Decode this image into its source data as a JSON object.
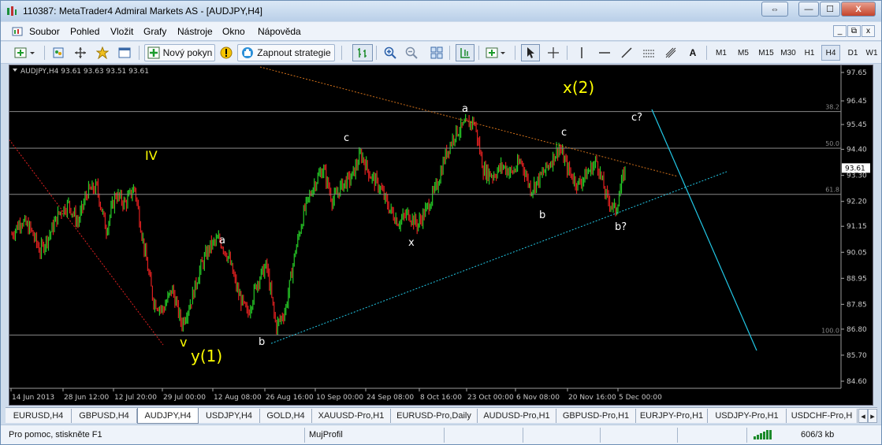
{
  "window": {
    "title": "110387: MetaTrader4 Admiral Markets AS - [AUDJPY,H4]",
    "buttons": {
      "switch": "⇔",
      "minimize": "—",
      "maximize": "☐",
      "close": "X"
    }
  },
  "menu": {
    "items": [
      "Soubor",
      "Pohled",
      "Vložit",
      "Grafy",
      "Nástroje",
      "Okno",
      "Nápověda"
    ],
    "mdi": {
      "minimize": "_",
      "restore": "⧉",
      "close": "x"
    }
  },
  "toolbar": {
    "new_order": "Nový pokyn",
    "autotrading": "Zapnout strategie",
    "text_tool": "A",
    "timeframes": [
      "M1",
      "M5",
      "M15",
      "M30",
      "H1",
      "H4",
      "D1",
      "W1"
    ],
    "active_timeframe": "H4"
  },
  "chart": {
    "header": "AUDJPY,H4  93.61 93.63 93.51 93.61",
    "current_price": "93.61",
    "colors": {
      "bg": "#000000",
      "bull": "#26c826",
      "bear": "#e02020",
      "grid": "#5a5a5a",
      "text": "#c8c8c8",
      "wave_white": "#ffffff",
      "wave_yellow": "#ffff00",
      "trend_orange": "#d0701a",
      "trend_cyan": "#22c8e6",
      "fib": "#888888"
    },
    "fib_levels": [
      {
        "label": "38.2",
        "price": 96.0
      },
      {
        "label": "50.0",
        "price": 94.45
      },
      {
        "label": "61.8",
        "price": 92.5
      },
      {
        "label": "100.0",
        "price": 86.55
      }
    ],
    "annotations": [
      {
        "text": "x(2)",
        "color": "yellow",
        "size": "large"
      },
      {
        "text": "IV",
        "color": "yellow",
        "size": "medium"
      },
      {
        "text": "v",
        "color": "yellow",
        "size": "medium"
      },
      {
        "text": "y(1)",
        "color": "yellow",
        "size": "large"
      },
      {
        "text": "a",
        "color": "white",
        "size": "small"
      },
      {
        "text": "b",
        "color": "white",
        "size": "small"
      },
      {
        "text": "c",
        "color": "white",
        "size": "small"
      },
      {
        "text": "x",
        "color": "white",
        "size": "small"
      },
      {
        "text": "a",
        "color": "white",
        "size": "small"
      },
      {
        "text": "b",
        "color": "white",
        "size": "small"
      },
      {
        "text": "c",
        "color": "white",
        "size": "small"
      },
      {
        "text": "b?",
        "color": "white",
        "size": "small"
      },
      {
        "text": "c?",
        "color": "white",
        "size": "small"
      }
    ],
    "time_axis": [
      "14 Jun 2013",
      "28 Jun 12:00",
      "12 Jul 20:00",
      "29 Jul 00:00",
      "12 Aug 08:00",
      "26 Aug 16:00",
      "10 Sep 00:00",
      "24 Sep 08:00",
      "8 Oct 16:00",
      "23 Oct 00:00",
      "6 Nov 08:00",
      "20 Nov 16:00",
      "5 Dec 00:00"
    ]
  },
  "chart_data": {
    "type": "candlestick",
    "title": "AUDJPY,H4",
    "y_ticks": [
      "97.65",
      "96.45",
      "95.45",
      "94.40",
      "93.30",
      "92.20",
      "91.15",
      "90.05",
      "88.95",
      "87.85",
      "86.80",
      "85.70",
      "84.60"
    ],
    "x_ticks": [
      "14 Jun 2013",
      "28 Jun 12:00",
      "12 Jul 20:00",
      "29 Jul 00:00",
      "12 Aug 08:00",
      "26 Aug 16:00",
      "10 Sep 00:00",
      "24 Sep 08:00",
      "8 Oct 16:00",
      "23 Oct 00:00",
      "6 Nov 08:00",
      "20 Nov 16:00",
      "5 Dec 00:00"
    ],
    "ylim": [
      84.3,
      97.95
    ],
    "price_path": [
      90.8,
      91.4,
      91.0,
      90.1,
      90.8,
      91.7,
      92.1,
      91.3,
      92.6,
      92.8,
      91.0,
      92.5,
      92.1,
      92.8,
      90.3,
      88.0,
      87.6,
      88.5,
      87.0,
      88.0,
      89.4,
      90.3,
      90.6,
      89.8,
      88.3,
      87.4,
      88.8,
      89.5,
      86.9,
      87.6,
      90.0,
      91.8,
      92.9,
      93.6,
      92.2,
      92.9,
      93.2,
      94.2,
      93.3,
      92.8,
      91.9,
      91.3,
      91.7,
      91.2,
      91.9,
      92.8,
      94.2,
      95.1,
      95.4,
      95.6,
      93.5,
      93.3,
      93.7,
      93.4,
      93.9,
      92.7,
      93.2,
      93.8,
      94.5,
      93.5,
      92.9,
      93.4,
      93.9,
      92.4,
      91.8,
      93.61
    ]
  }
}
